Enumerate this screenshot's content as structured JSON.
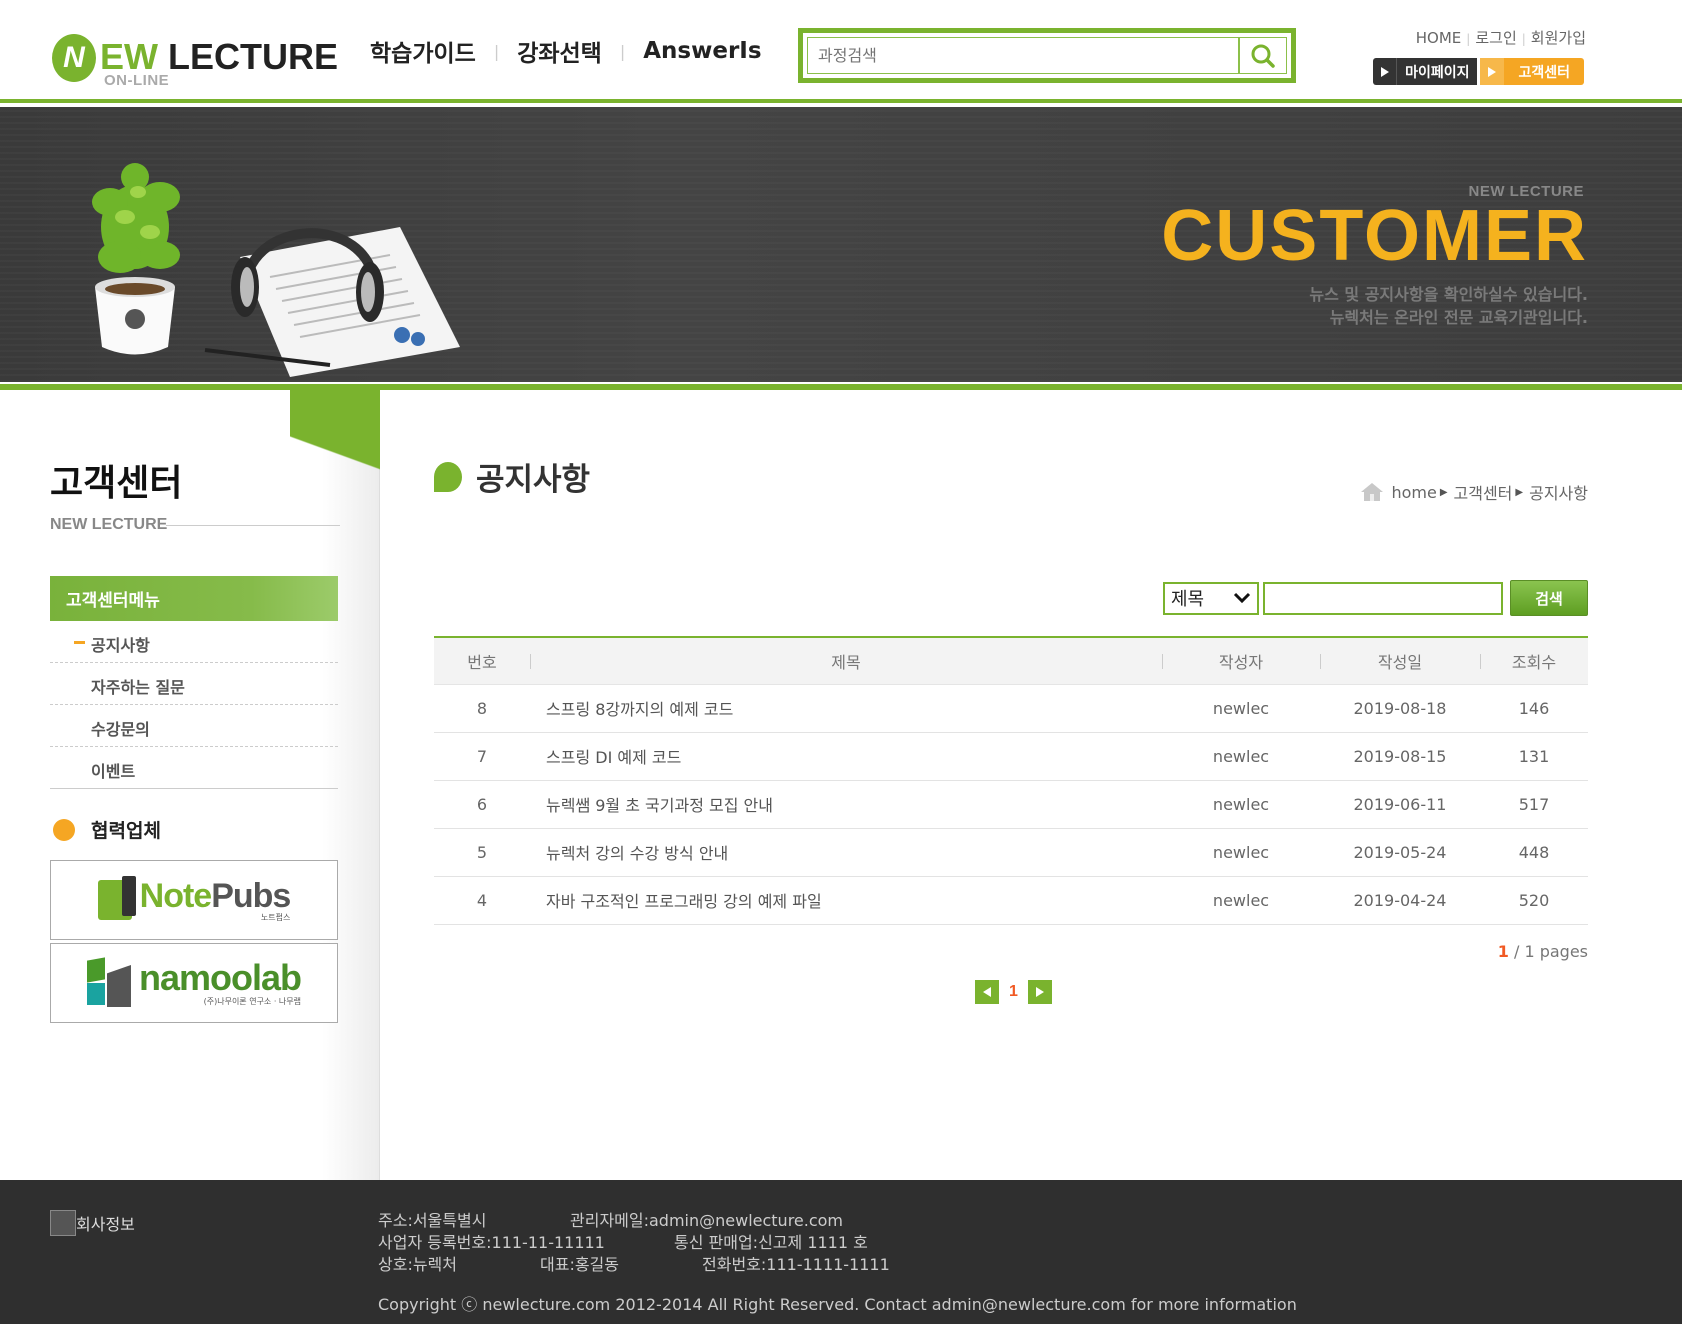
{
  "header": {
    "logo": {
      "text": "EW",
      "text2": "LECTURE",
      "initial": "N",
      "sub": "ON-LINE"
    },
    "nav": [
      "학습가이드",
      "강좌선택",
      "AnswerIs"
    ],
    "search": {
      "placeholder": "과정검색"
    },
    "toplinks": [
      "HOME",
      "로그인",
      "회원가입"
    ],
    "mypage_label": "마이페이지",
    "customer_label": "고객센터"
  },
  "visual": {
    "small": "NEW LECTURE",
    "big": "CUSTOMER",
    "desc1": "뉴스 및 공지사항을 확인하실수 있습니다.",
    "desc2": "뉴렉처는 온라인 전문 교육기관입니다."
  },
  "aside": {
    "title": "고객센터",
    "sub": "NEW LECTURE",
    "menu_head": "고객센터메뉴",
    "menu": [
      "공지사항",
      "자주하는 질문",
      "수강문의",
      "이벤트"
    ],
    "partner_title": "협력업체",
    "partners": {
      "p1": {
        "name1": "Note",
        "name2": "Pubs",
        "tagline": "노트펍스"
      },
      "p2": {
        "name": "namoolab",
        "tagline": "(주)나무이론 연구소 · 나무랩"
      }
    }
  },
  "main": {
    "title": "공지사항",
    "breadcrumb": [
      "home",
      "고객센터",
      "공지사항"
    ],
    "search": {
      "select": "제목",
      "query": "",
      "button": "검색"
    },
    "columns": [
      "번호",
      "제목",
      "작성자",
      "작성일",
      "조회수"
    ],
    "rows": [
      {
        "id": "8",
        "title": "스프링 8강까지의 예제 코드",
        "writer": "newlec",
        "date": "2019-08-18",
        "hit": "146"
      },
      {
        "id": "7",
        "title": "스프링 DI 예제 코드",
        "writer": "newlec",
        "date": "2019-08-15",
        "hit": "131"
      },
      {
        "id": "6",
        "title": "뉴렉쌤 9월 초 국기과정 모집 안내",
        "writer": "newlec",
        "date": "2019-06-11",
        "hit": "517"
      },
      {
        "id": "5",
        "title": "뉴렉처 강의 수강 방식 안내",
        "writer": "newlec",
        "date": "2019-05-24",
        "hit": "448"
      },
      {
        "id": "4",
        "title": "자바 구조적인 프로그래밍 강의 예제 파일",
        "writer": "newlec",
        "date": "2019-04-24",
        "hit": "520"
      }
    ],
    "pageinfo": {
      "current": "1",
      "rest": " / 1 pages"
    },
    "pager": {
      "current": "1"
    }
  },
  "footer": {
    "logo_alt": "회사정보",
    "address": "주소:서울특별시",
    "email": "관리자메일:admin@newlecture.com",
    "biz_no": "사업자 등록번호:111-11-11111",
    "sales_no": "통신 판매업:신고제 1111 호",
    "company": "상호:뉴렉처",
    "ceo": "대표:홍길동",
    "phone": "전화번호:111-1111-1111",
    "copyright": "Copyright ⓒ newlecture.com 2012-2014 All Right Reserved. Contact admin@newlecture.com for more information"
  },
  "colors": {
    "accent": "#7ab32e",
    "orange": "#f5a623",
    "banner_text": "#f5b21e",
    "page_current": "#f15a24"
  }
}
